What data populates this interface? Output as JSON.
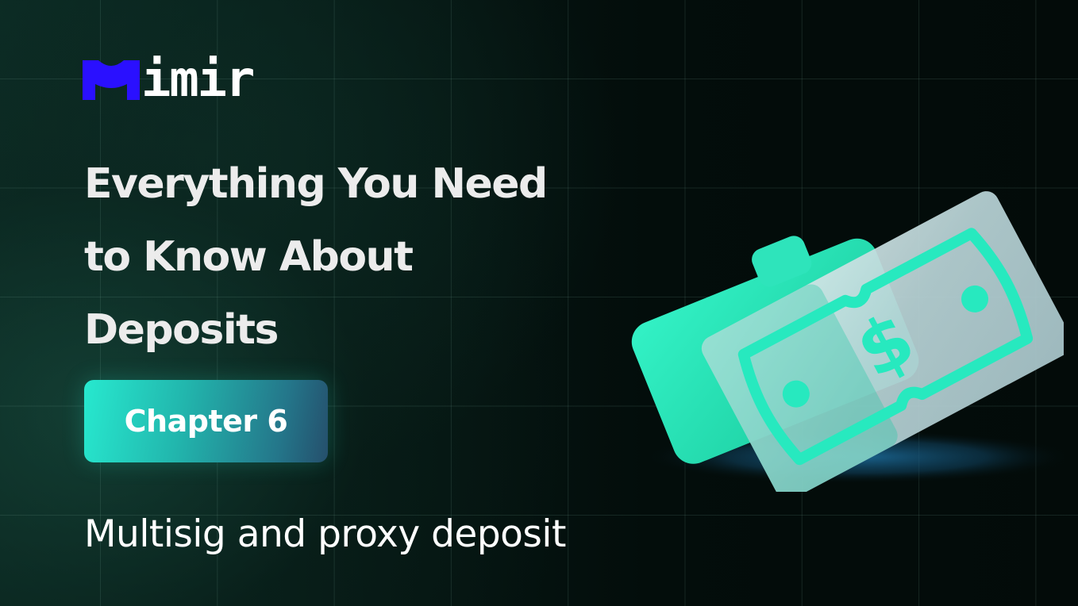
{
  "brand": {
    "name": "Mimir",
    "logo_mark_letter": "M",
    "logo_rest_text": "imir",
    "logo_mark_color": "#2a10ff"
  },
  "title": {
    "lines": [
      "Everything You Need",
      "to Know About",
      "Deposits"
    ]
  },
  "chapter_badge": {
    "label": "Chapter 6"
  },
  "subtitle": "Multisig and proxy deposit",
  "illustration": {
    "icon": "money-bill-icon",
    "symbol": "$",
    "accent_color": "#27e9bf",
    "glass_color": "#c6d9dc",
    "shadow_color": "#1c6c9c"
  },
  "colors": {
    "background": "#030c0a",
    "text": "#ffffff",
    "badge_gradient_start": "#27e9cf",
    "badge_gradient_end": "#254f6c"
  }
}
